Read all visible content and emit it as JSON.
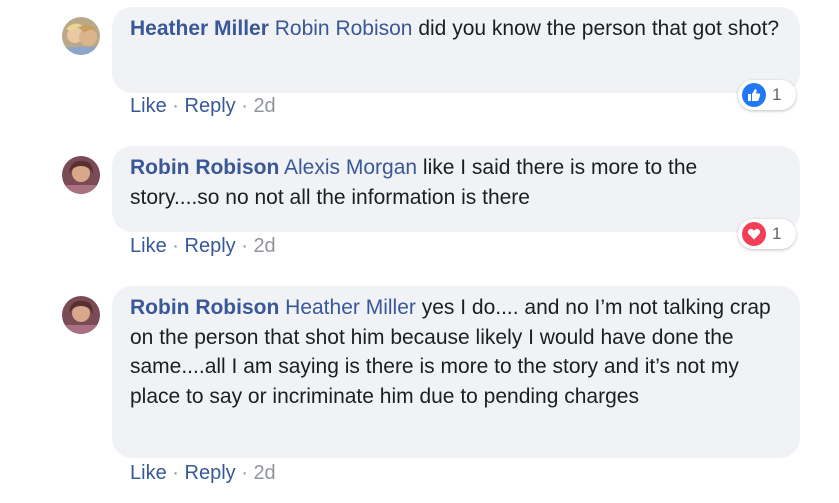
{
  "comments": [
    {
      "author": "Heather Miller",
      "mention": "Robin Robison",
      "text": " did you know the person that got shot?",
      "actions": {
        "like": "Like",
        "reply": "Reply",
        "time": "2d"
      },
      "reaction": {
        "icon": "thumbs-up-icon",
        "count": "1",
        "color": "#2078f4"
      }
    },
    {
      "author": "Robin Robison",
      "mention": "Alexis Morgan",
      "text": " like I said there is more to the story....so no not all the information is there",
      "actions": {
        "like": "Like",
        "reply": "Reply",
        "time": "2d"
      },
      "reaction": {
        "icon": "heart-icon",
        "count": "1",
        "color": "#f33e58"
      }
    },
    {
      "author": "Robin Robison",
      "mention": "Heather Miller",
      "text": " yes I do.... and no I’m not talking crap on the person that shot him because likely I would have done the same....all I am saying is there is more to the story and it’s not my place to say or incriminate him due to pending charges",
      "actions": {
        "like": "Like",
        "reply": "Reply",
        "time": "2d"
      }
    }
  ],
  "separator": "·"
}
